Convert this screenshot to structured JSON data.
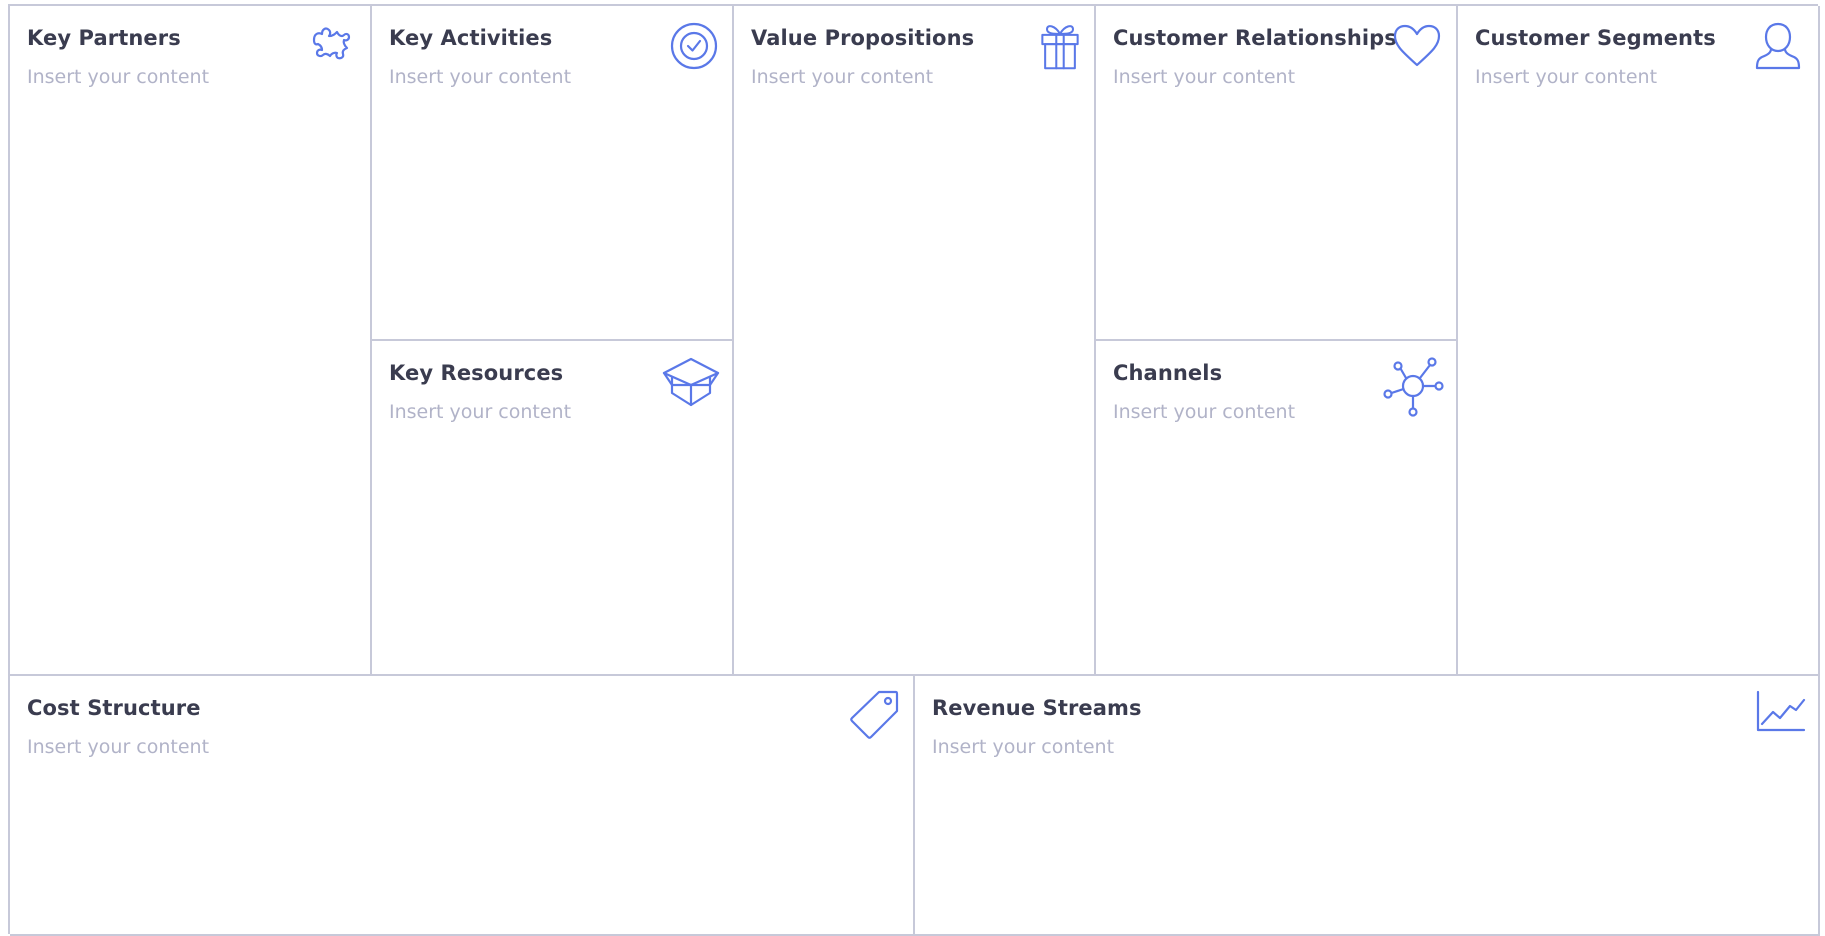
{
  "accent_color": "#5a78e8",
  "border_color": "#c7c9d9",
  "blocks": {
    "key_partners": {
      "title": "Key Partners",
      "content": "Insert your content",
      "icon": "puzzle-icon"
    },
    "key_activities": {
      "title": "Key Activities",
      "content": "Insert your content",
      "icon": "check-circle-icon"
    },
    "key_resources": {
      "title": "Key Resources",
      "content": "Insert your content",
      "icon": "box-icon"
    },
    "value_propositions": {
      "title": "Value Propositions",
      "content": "Insert your content",
      "icon": "gift-icon"
    },
    "customer_relationships": {
      "title": "Customer Relationships",
      "content": "Insert your content",
      "icon": "heart-icon"
    },
    "channels": {
      "title": "Channels",
      "content": "Insert your content",
      "icon": "network-icon"
    },
    "customer_segments": {
      "title": "Customer Segments",
      "content": "Insert your content",
      "icon": "user-icon"
    },
    "cost_structure": {
      "title": "Cost Structure",
      "content": "Insert your content",
      "icon": "price-tag-icon"
    },
    "revenue_streams": {
      "title": "Revenue Streams",
      "content": "Insert your content",
      "icon": "line-chart-icon"
    }
  }
}
